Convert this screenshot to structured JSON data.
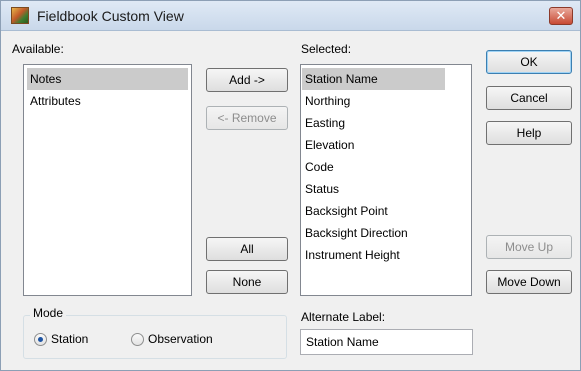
{
  "window": {
    "title": "Fieldbook Custom View",
    "close_glyph": "✕"
  },
  "available": {
    "label": "Available:",
    "items": [
      "Notes",
      "Attributes"
    ],
    "selected_index": 0
  },
  "selected": {
    "label": "Selected:",
    "items": [
      "Station Name",
      "Northing",
      "Easting",
      "Elevation",
      "Code",
      "Status",
      "Backsight Point",
      "Backsight Direction",
      "Instrument Height"
    ],
    "selected_index": 0
  },
  "buttons": {
    "add": "Add ->",
    "remove": "<- Remove",
    "all": "All",
    "none": "None",
    "ok": "OK",
    "cancel": "Cancel",
    "help": "Help",
    "move_up": "Move Up",
    "move_down": "Move Down"
  },
  "mode": {
    "label": "Mode",
    "options": [
      {
        "label": "Station",
        "checked": true
      },
      {
        "label": "Observation",
        "checked": false
      }
    ]
  },
  "alternate_label": {
    "label": "Alternate Label:",
    "value": "Station Name"
  },
  "icons": {
    "app": "fieldbook-app-icon",
    "close": "close-icon"
  }
}
